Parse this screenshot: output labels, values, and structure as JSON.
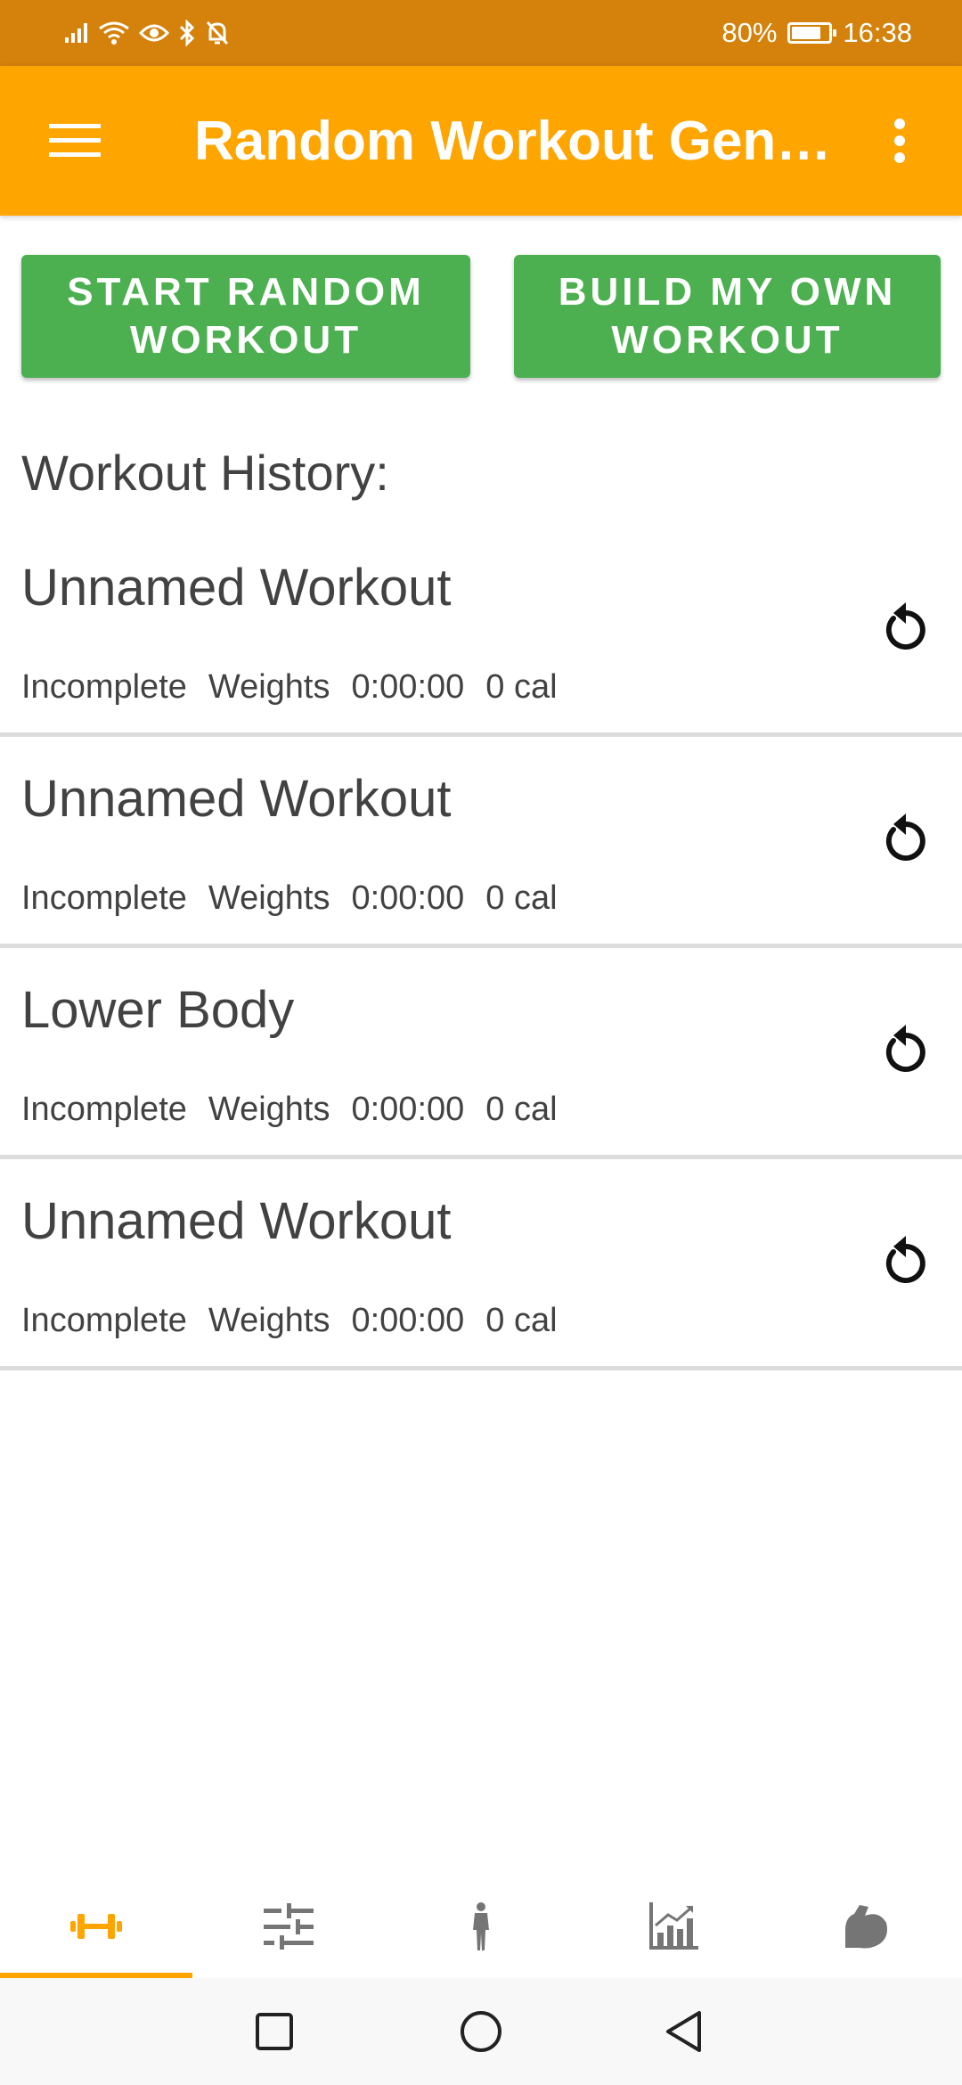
{
  "status_bar": {
    "battery_percent": "80%",
    "battery_level": 0.8,
    "time": "16:38",
    "icons": [
      "signal-icon",
      "wifi-icon",
      "eye-icon",
      "bluetooth-icon",
      "notifications-off-icon"
    ]
  },
  "app_bar": {
    "title": "Random Workout Gen…",
    "menu_icon": "hamburger-menu-icon",
    "more_icon": "more-vert-icon",
    "background": "#FFA500"
  },
  "actions": {
    "start_random": "START RANDOM\nWORKOUT",
    "build_own": "BUILD MY OWN\nWORKOUT",
    "color": "#4CAF50"
  },
  "history": {
    "heading": "Workout History:",
    "items": [
      {
        "title": "Unnamed Workout",
        "status": "Incomplete",
        "type": "Weights",
        "duration": "0:00:00",
        "calories": "0 cal"
      },
      {
        "title": "Unnamed Workout",
        "status": "Incomplete",
        "type": "Weights",
        "duration": "0:00:00",
        "calories": "0 cal"
      },
      {
        "title": "Lower Body",
        "status": "Incomplete",
        "type": "Weights",
        "duration": "0:00:00",
        "calories": "0 cal"
      },
      {
        "title": "Unnamed Workout",
        "status": "Incomplete",
        "type": "Weights",
        "duration": "0:00:00",
        "calories": "0 cal"
      }
    ]
  },
  "bottom_nav": {
    "items": [
      {
        "icon": "dumbbell-icon",
        "active": true
      },
      {
        "icon": "sliders-icon",
        "active": false
      },
      {
        "icon": "body-icon",
        "active": false
      },
      {
        "icon": "chart-icon",
        "active": false
      },
      {
        "icon": "bicep-icon",
        "active": false
      }
    ],
    "active_color": "#FFA500",
    "inactive_color": "#757575"
  },
  "system_nav": {
    "icons": [
      "recents-icon",
      "home-icon",
      "back-icon"
    ]
  }
}
